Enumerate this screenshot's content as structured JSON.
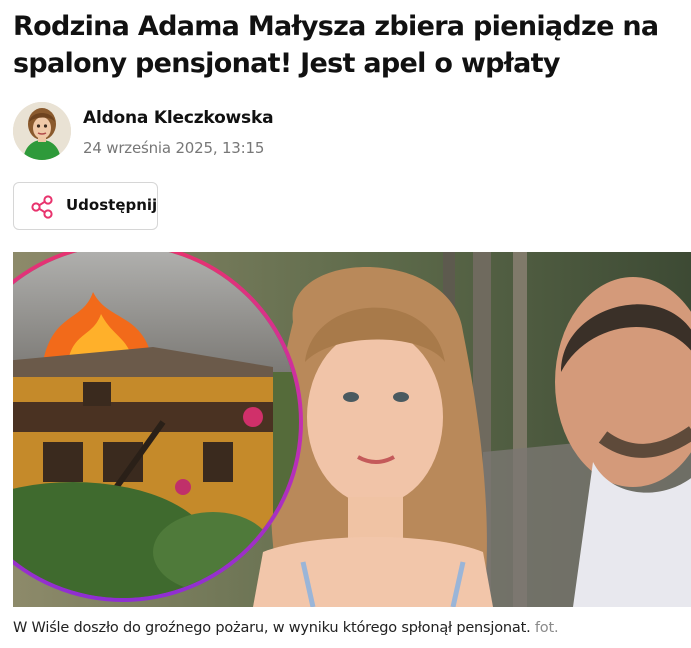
{
  "article": {
    "headline": "Rodzina Adama Małysza zbiera pieniądze na spalony pensjonat! Jest apel o wpłaty",
    "author": {
      "name": "Aldona Kleczkowska",
      "date": "24 września 2025, 13:15"
    },
    "share": {
      "label": "Udostępnij",
      "icon": "share-icon"
    },
    "image": {
      "caption": "W Wiśle doszło do groźnego pożaru, w wyniku którego spłonął pensjonat.",
      "credit": "fot."
    }
  },
  "colors": {
    "accent_pink": "#e8336d",
    "accent_purple": "#9b2fd0",
    "text": "#111111",
    "muted": "#777777"
  }
}
